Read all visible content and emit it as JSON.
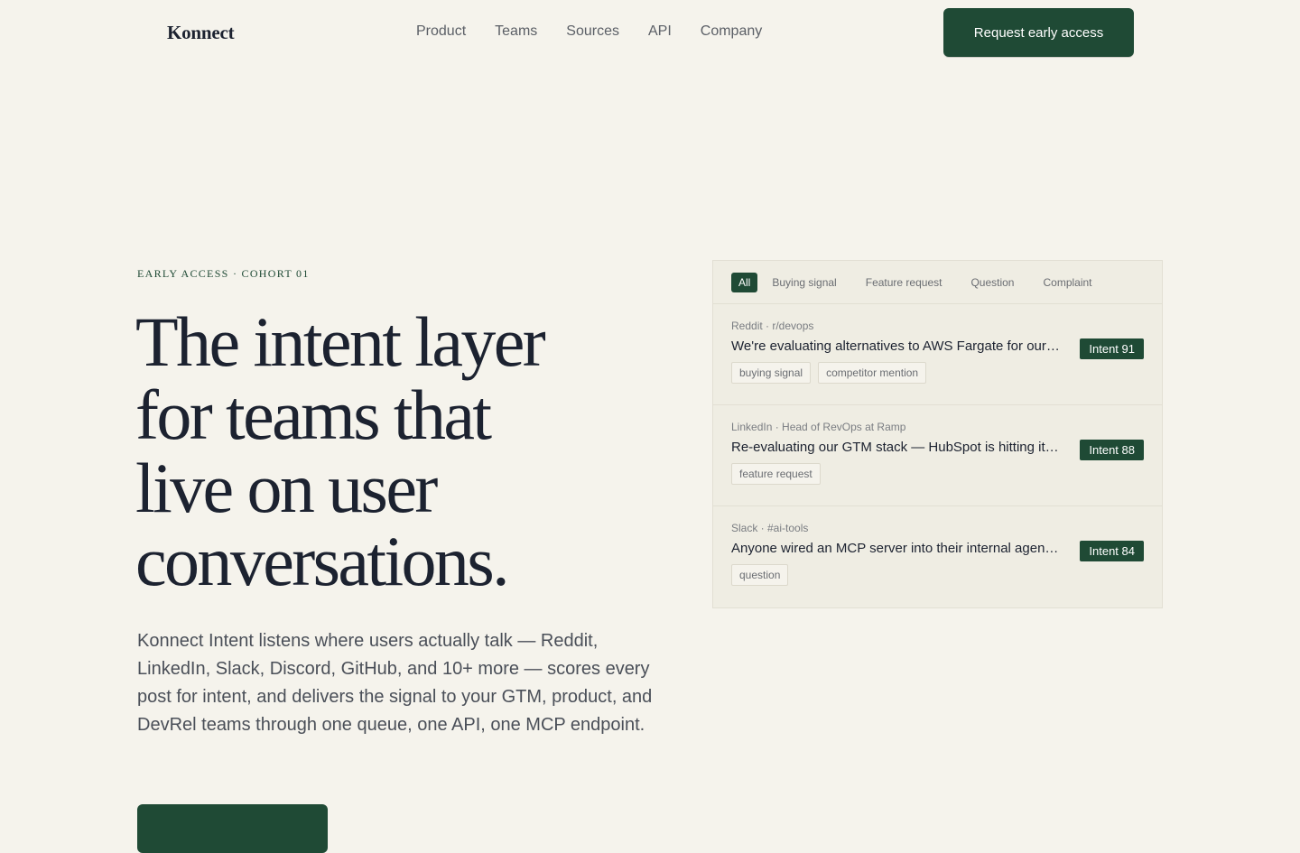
{
  "nav": {
    "logo": "Konnect",
    "links": [
      "Product",
      "Teams",
      "Sources",
      "API",
      "Company"
    ],
    "cta": "Request early access"
  },
  "hero": {
    "eyebrow": "EARLY ACCESS · COHORT 01",
    "headline_lines": [
      "The intent layer",
      "for teams that",
      "live on user",
      "conversations."
    ],
    "subtext": "Konnect Intent listens where users actually talk — Reddit, LinkedIn, Slack, Discord, GitHub, and 10+ more — scores every post for intent, and delivers the signal to your GTM, product, and DevRel teams through one queue, one API, one MCP endpoint."
  },
  "feed": {
    "filters": [
      "All",
      "Buying signal",
      "Feature request",
      "Question",
      "Complaint"
    ],
    "active_filter": "All",
    "items": [
      {
        "source": "Reddit · r/devops",
        "title": "We're evaluating alternatives to AWS Fargate for our workloads",
        "score": "Intent 91",
        "tags": [
          "buying signal",
          "competitor mention"
        ]
      },
      {
        "source": "LinkedIn · Head of RevOps at Ramp",
        "title": "Re-evaluating our GTM stack — HubSpot is hitting its limits",
        "score": "Intent 88",
        "tags": [
          "feature request"
        ]
      },
      {
        "source": "Slack · #ai-tools",
        "title": "Anyone wired an MCP server into their internal agents yet?",
        "score": "Intent 84",
        "tags": [
          "question"
        ]
      }
    ]
  },
  "colors": {
    "background": "#f5f3ec",
    "accent": "#1f4a35",
    "panel": "#efede3",
    "text": "#1c2230"
  }
}
